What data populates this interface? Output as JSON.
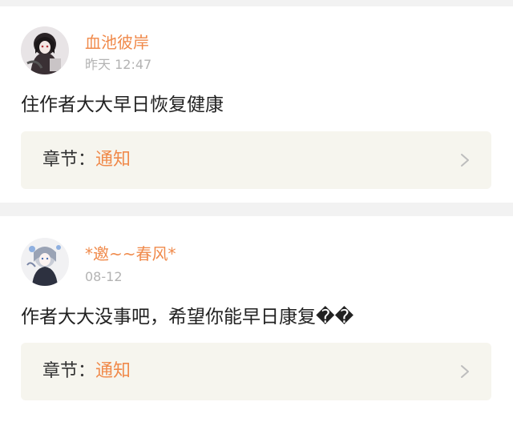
{
  "comments": [
    {
      "username": "血池彼岸",
      "timestamp": "昨天 12:47",
      "text": "住作者大大早日恢复健康",
      "chapter_prefix": "章节：",
      "chapter_name": "通知"
    },
    {
      "username": "*邀~~春风*",
      "timestamp": "08-12",
      "text": "作者大大没事吧，希望你能早日康复��",
      "chapter_prefix": "章节：",
      "chapter_name": "通知"
    }
  ],
  "icons": {
    "chevron": "chevron-right-icon",
    "avatar": "user-avatar"
  },
  "colors": {
    "accent": "#f08a4b",
    "chapter_bg": "#f6f5ee",
    "timestamp": "#b3b3b3",
    "text": "#222222"
  }
}
